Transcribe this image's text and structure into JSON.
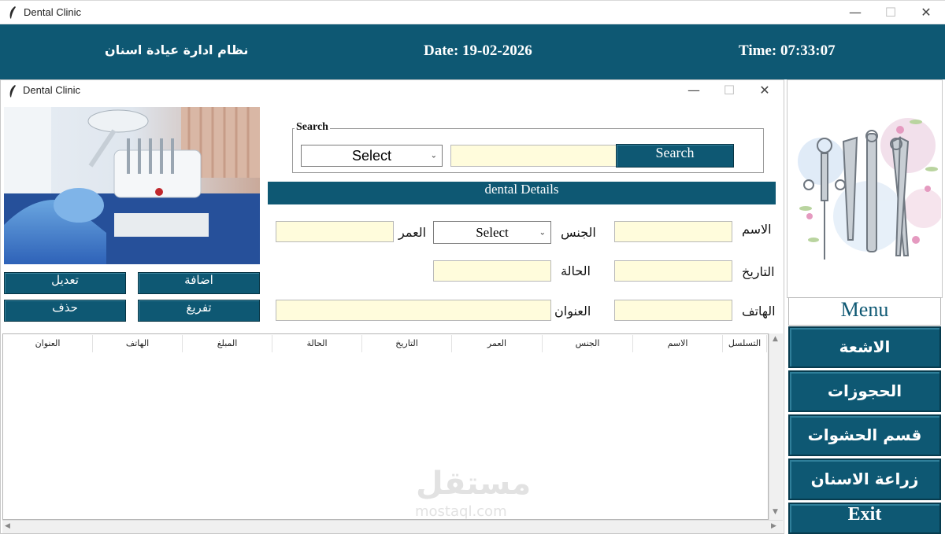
{
  "window": {
    "title": "Dental Clinic",
    "minimize": "—",
    "maximize": "☐",
    "close": "✕"
  },
  "header": {
    "system_name": "نظام ادارة عيادة اسنان",
    "date": "Date: 19-02-2026",
    "time": "Time: 07:33:07"
  },
  "inner_window": {
    "title": "Dental Clinic",
    "minimize": "—",
    "maximize": "☐",
    "close": "✕"
  },
  "search": {
    "legend": "Search",
    "select_value": "Select",
    "input_value": "",
    "button_label": "Search"
  },
  "section_title": "dental Details",
  "form": {
    "name_label": "الاسم",
    "name_value": "",
    "gender_label": "الجنس",
    "gender_value": "Select",
    "age_label": "العمر",
    "age_value": "",
    "date_label": "التاريخ",
    "date_value": "",
    "status_label": "الحالة",
    "status_value": "",
    "phone_label": "الهاتف",
    "phone_value": "",
    "address_label": "العنوان",
    "address_value": ""
  },
  "actions": {
    "add": "اضافة",
    "edit": "تعديل",
    "clear": "تفريغ",
    "delete": "حذف"
  },
  "table": {
    "columns": [
      "التسلسل",
      "الاسم",
      "الجنس",
      "العمر",
      "التاريخ",
      "الحالة",
      "المبلغ",
      "الهاتف",
      "العنوان"
    ],
    "rows": []
  },
  "menu": {
    "title": "Menu",
    "items": [
      "الاشعة",
      "الحجوزات",
      "قسم الحشوات",
      "زراعة الاسنان"
    ],
    "exit": "Exit"
  },
  "watermark": {
    "arabic": "مستقل",
    "latin": "mostaql.com"
  },
  "colors": {
    "teal": "#0e5873",
    "field_yellow": "#fffcdc"
  }
}
